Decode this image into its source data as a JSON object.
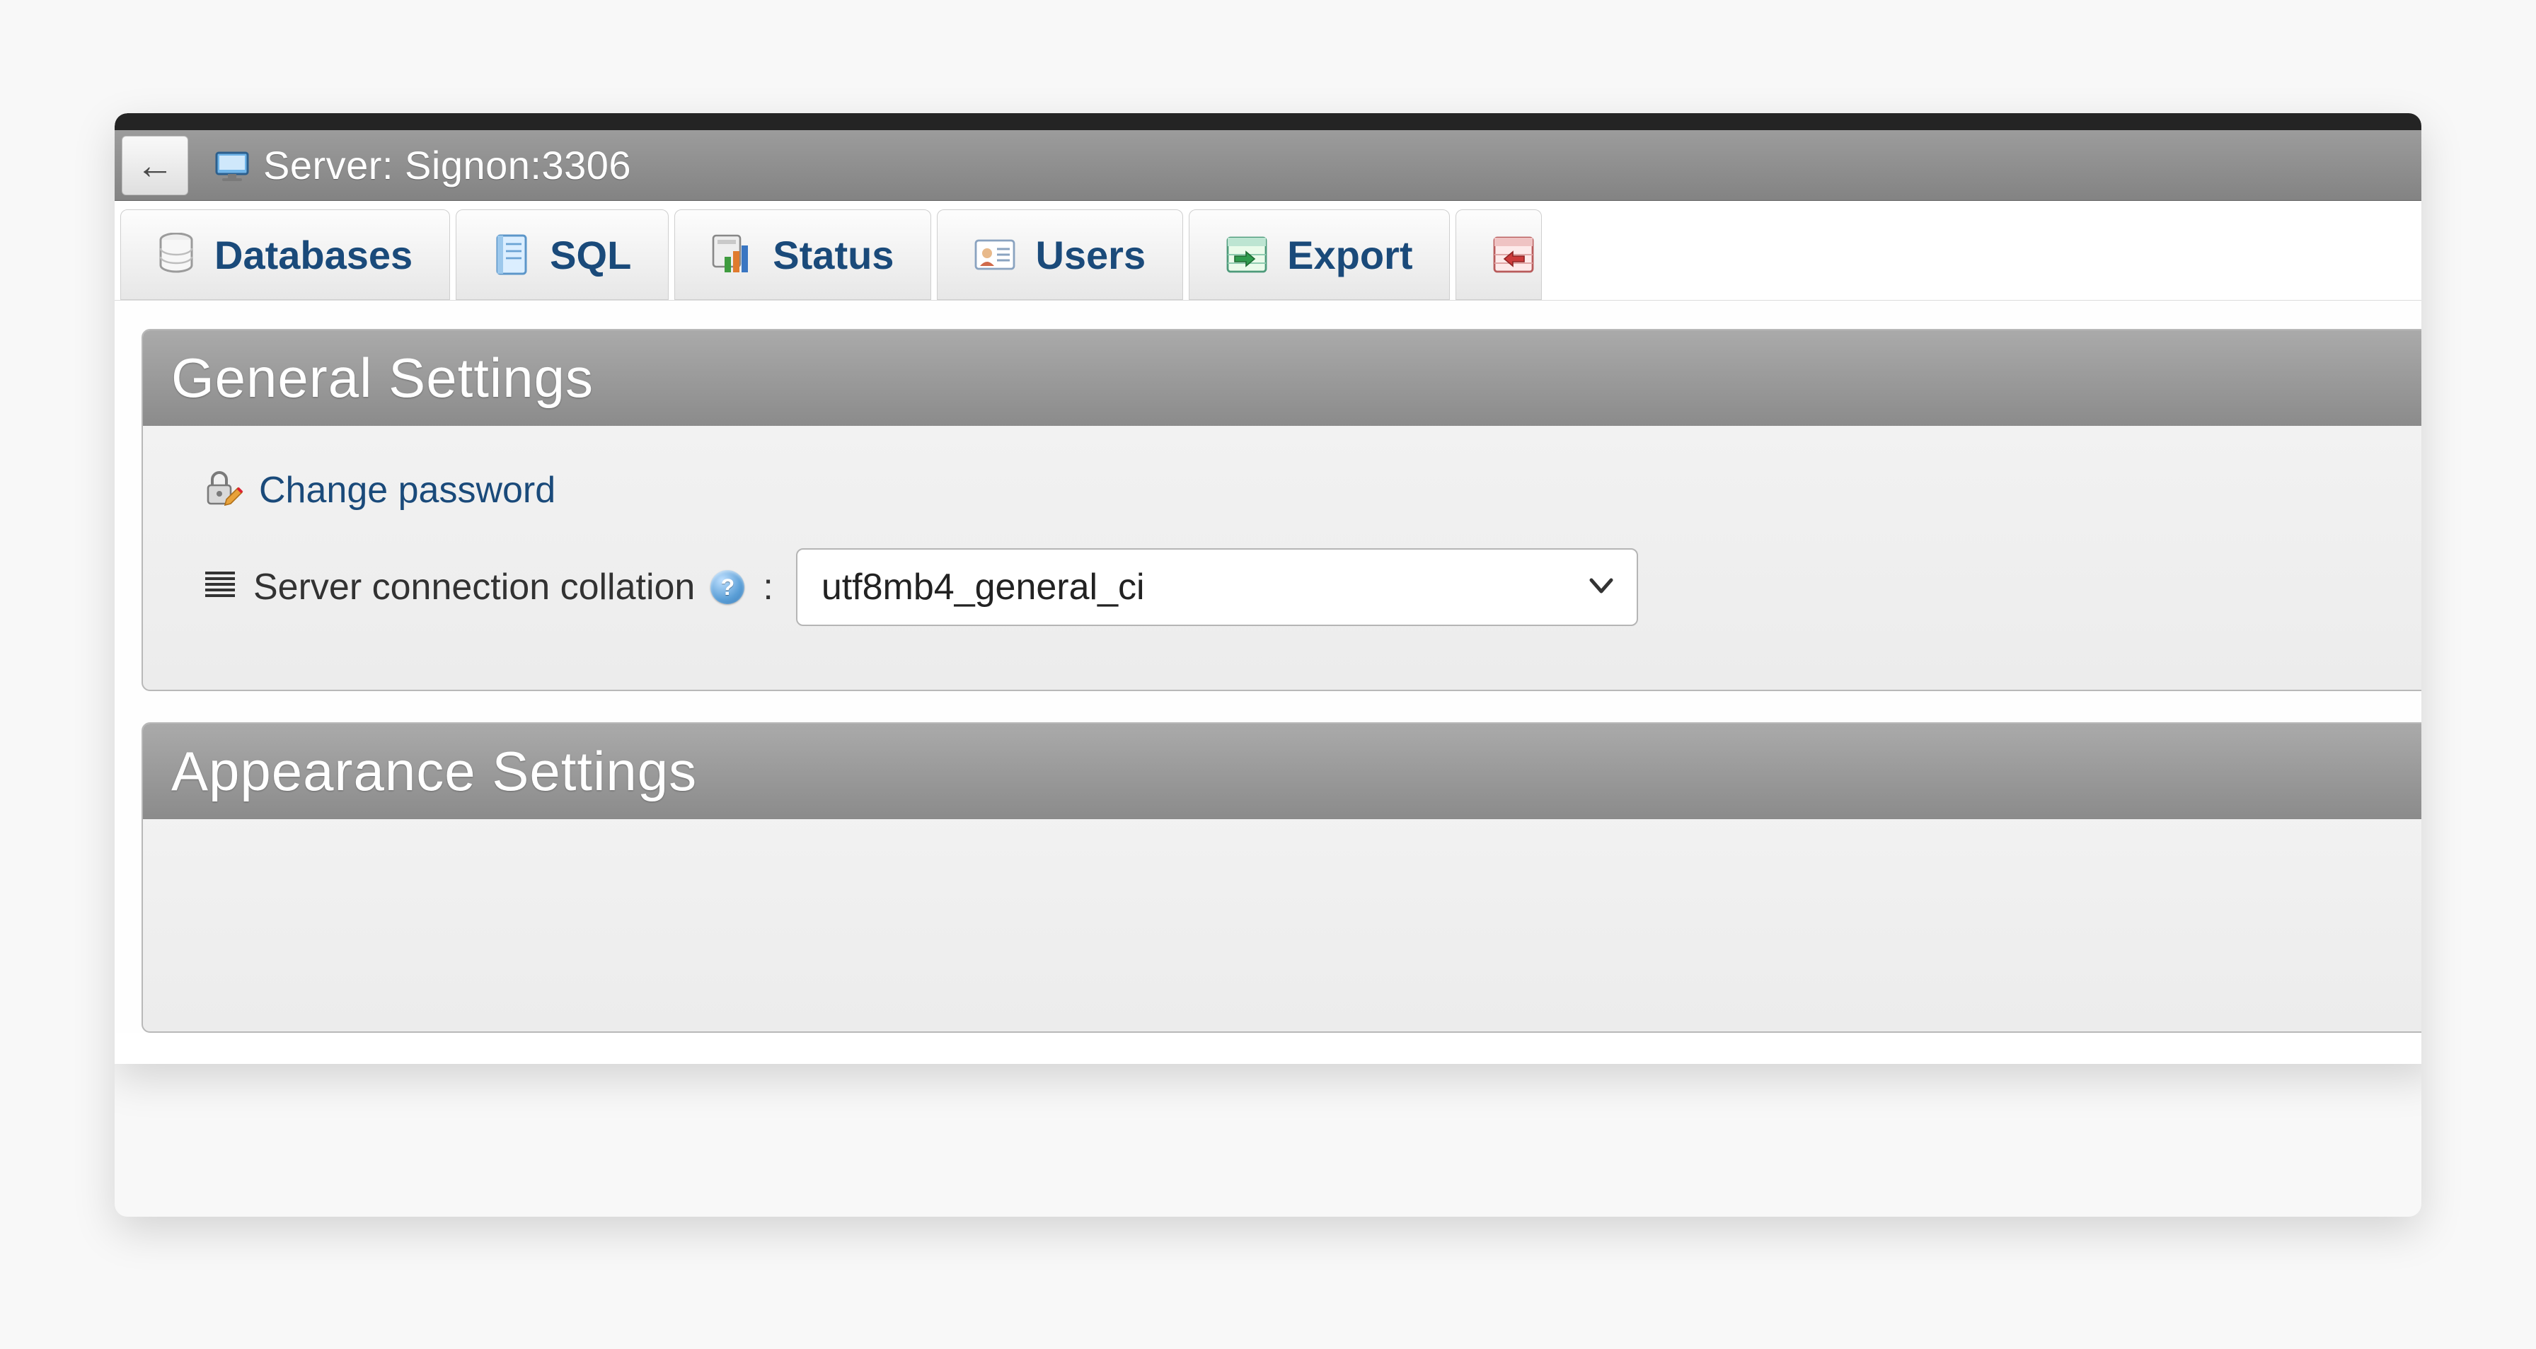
{
  "breadcrumb": {
    "label": "Server: Signon:3306"
  },
  "tabs": [
    {
      "id": "databases",
      "label": "Databases"
    },
    {
      "id": "sql",
      "label": "SQL"
    },
    {
      "id": "status",
      "label": "Status"
    },
    {
      "id": "users",
      "label": "Users"
    },
    {
      "id": "export",
      "label": "Export"
    }
  ],
  "panels": {
    "general": {
      "title": "General Settings",
      "change_password_label": "Change password",
      "collation_label": "Server connection collation",
      "collation_value": "utf8mb4_general_ci"
    },
    "appearance": {
      "title": "Appearance Settings"
    }
  }
}
